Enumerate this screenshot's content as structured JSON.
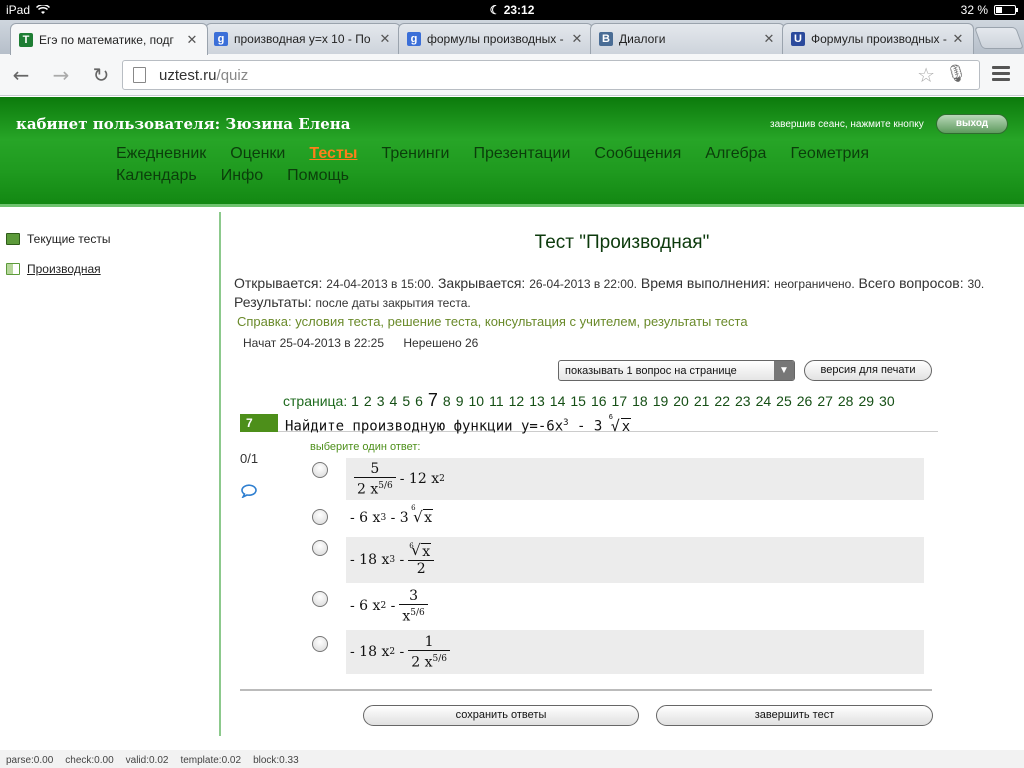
{
  "statusbar": {
    "device": "iPad",
    "time": "23:12",
    "battery": "32 %",
    "battery_level": 0.32
  },
  "tabs": [
    {
      "title": "Егэ по математике, подг",
      "favicon_color": "#1e7e34",
      "favicon_text": "Т",
      "active": true
    },
    {
      "title": "производная у=х 10 - По",
      "favicon_color": "#3b6fd8",
      "favicon_text": "g",
      "active": false
    },
    {
      "title": "формулы производных -",
      "favicon_color": "#3b6fd8",
      "favicon_text": "g",
      "active": false
    },
    {
      "title": "Диалоги",
      "favicon_color": "#4a6d95",
      "favicon_text": "B",
      "active": false
    },
    {
      "title": "Формулы производных -",
      "favicon_color": "#2b4a9c",
      "favicon_text": "U",
      "active": false
    }
  ],
  "omnibox": {
    "host": "uztest.ru",
    "path": "/quiz"
  },
  "header": {
    "cabinet": "кабинет пользователя: Зюзина Елена",
    "logout_hint": "завершив сеанс, нажмите кнопку",
    "logout_button": "выход",
    "nav_row1": [
      "Ежедневник",
      "Оценки",
      "Тесты",
      "Тренинги",
      "Презентации",
      "Сообщения",
      "Алгебра",
      "Геометрия"
    ],
    "nav_row2": [
      "Календарь",
      "Инфо",
      "Помощь"
    ],
    "active_nav": "Тесты"
  },
  "sidebar": {
    "items": [
      {
        "label": "Текущие тесты"
      },
      {
        "label": "Производная"
      }
    ]
  },
  "test": {
    "title": "Тест \"Производная\"",
    "opens_label": "Открывается:",
    "opens_value": "24-04-2013 в 15:00.",
    "closes_label": "Закрывается:",
    "closes_value": "26-04-2013 в 22:00.",
    "time_label": "Время выполнения:",
    "time_value": "неограничено.",
    "total_label": "Всего вопросов:",
    "total_value": "30.",
    "results_label": "Результаты:",
    "results_value": "после даты закрытия теста.",
    "help_text": "Справка: условия теста, решение теста, консультация с учителем, результаты теста",
    "started": "Начат 25-04-2013 в 22:25",
    "unsolved": "Нерешено 26",
    "per_page_select": "показывать 1 вопрос на странице",
    "print_button": "версия для печати",
    "pager_label": "страница:",
    "pages": [
      "1",
      "2",
      "3",
      "4",
      "5",
      "6",
      "7",
      "8",
      "9",
      "10",
      "11",
      "12",
      "13",
      "14",
      "15",
      "16",
      "17",
      "18",
      "19",
      "20",
      "21",
      "22",
      "23",
      "24",
      "25",
      "26",
      "27",
      "28",
      "29",
      "30"
    ],
    "current_page": "7",
    "question_number": "7",
    "question_text": "Найдите производную функции y=-6x",
    "question_exp": "3",
    "question_tail": " - 3",
    "root_index": "6",
    "root_var": "x",
    "choose_label": "выберите один ответ:",
    "score": "0/1",
    "answers": {
      "a1_num": "5",
      "a1_den": "2 x",
      "a1_den_exp": "5/6",
      "a1_tail": "- 12 x",
      "a1_tail_exp": "2",
      "a2_pre": "- 6 x",
      "a2_pre_exp": "3",
      "a2_mid": "- 3",
      "a3_pre": "- 18 x",
      "a3_pre_exp": "3",
      "a3_mid": "-",
      "a3_den": "2",
      "a4_pre": "- 6 x",
      "a4_pre_exp": "2",
      "a4_mid": "-",
      "a4_num": "3",
      "a4_den": "x",
      "a4_den_exp": "5/6",
      "a5_pre": "- 18 x",
      "a5_pre_exp": "2",
      "a5_mid": "-",
      "a5_num": "1",
      "a5_den": "2 x",
      "a5_den_exp": "5/6"
    },
    "save_button": "сохранить ответы",
    "finish_button": "завершить тест"
  },
  "debug": [
    "parse:0.00",
    "check:0.00",
    "valid:0.02",
    "template:0.02",
    "block:0.33"
  ]
}
